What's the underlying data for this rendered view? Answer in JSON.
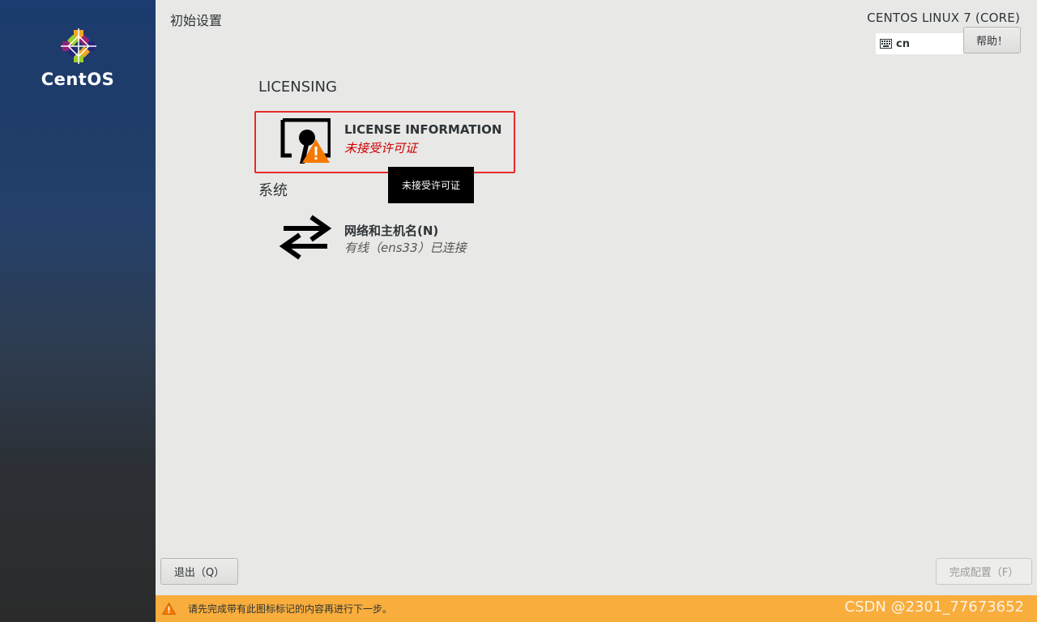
{
  "sidebar": {
    "logo_text": "CentOS",
    "logo_icon": "centos-logo-icon"
  },
  "header": {
    "page_title": "初始设置",
    "product_name": "CENTOS LINUX 7 (CORE)",
    "keyboard_layout": "cn",
    "keyboard_icon": "keyboard-icon",
    "help_button": "帮助！"
  },
  "sections": [
    {
      "label": "LICENSING",
      "spokes": [
        {
          "title": "LICENSE INFORMATION",
          "status": "未接受许可证",
          "status_color": "#cc0000",
          "icon": "license-warning-icon"
        }
      ]
    },
    {
      "label": "系统",
      "spokes": [
        {
          "title": "网络和主机名(N)",
          "status": "有线（ens33）已连接",
          "status_color": "#555753",
          "icon": "network-arrows-icon"
        }
      ]
    }
  ],
  "tooltip": "未接受许可证",
  "footer": {
    "quit_button": "退出（Q）",
    "finish_button": "完成配置（F）",
    "warning_icon": "warning-icon",
    "warning_text": "请先完成带有此图标标记的内容再进行下一步。",
    "warning_bar_color": "#f8ad3c",
    "watermark": "CSDN @2301_77673652"
  },
  "colors": {
    "highlight_border": "#e82a2a",
    "accent_orange": "#f57900"
  }
}
